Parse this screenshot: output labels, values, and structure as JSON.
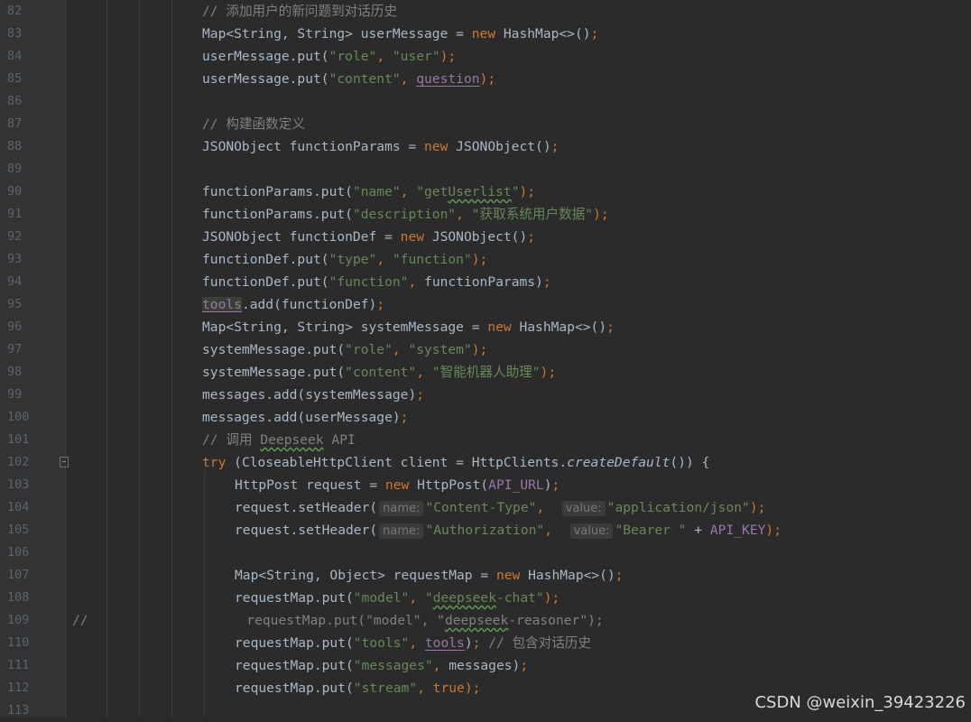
{
  "editor": {
    "lines": [
      {
        "num": "82",
        "indent": 1,
        "tokens": [
          {
            "t": "// 添加用户的新问题到对话历史",
            "c": "comment"
          }
        ]
      },
      {
        "num": "83",
        "indent": 1,
        "tokens": [
          {
            "t": "Map<String, String> userMessage = ",
            "c": "default"
          },
          {
            "t": "new ",
            "c": "keyword"
          },
          {
            "t": "HashMap<>()",
            "c": "default"
          },
          {
            "t": ";",
            "c": "keyword"
          }
        ]
      },
      {
        "num": "84",
        "indent": 1,
        "tokens": [
          {
            "t": "userMessage.put(",
            "c": "default"
          },
          {
            "t": "\"role\"",
            "c": "string"
          },
          {
            "t": ", ",
            "c": "keyword"
          },
          {
            "t": "\"user\"",
            "c": "string"
          },
          {
            "t": ");",
            "c": "keyword"
          }
        ]
      },
      {
        "num": "85",
        "indent": 1,
        "tokens": [
          {
            "t": "userMessage.put(",
            "c": "default"
          },
          {
            "t": "\"content\"",
            "c": "string"
          },
          {
            "t": ", ",
            "c": "keyword"
          },
          {
            "t": "question",
            "c": "field",
            "u": true
          },
          {
            "t": ");",
            "c": "keyword"
          }
        ]
      },
      {
        "num": "86",
        "indent": 1,
        "tokens": []
      },
      {
        "num": "87",
        "indent": 1,
        "tokens": [
          {
            "t": "// 构建函数定义",
            "c": "comment"
          }
        ]
      },
      {
        "num": "88",
        "indent": 1,
        "tokens": [
          {
            "t": "JSONObject functionParams = ",
            "c": "default"
          },
          {
            "t": "new ",
            "c": "keyword"
          },
          {
            "t": "JSONObject()",
            "c": "default"
          },
          {
            "t": ";",
            "c": "keyword"
          }
        ]
      },
      {
        "num": "89",
        "indent": 1,
        "tokens": []
      },
      {
        "num": "90",
        "indent": 1,
        "tokens": [
          {
            "t": "functionParams.put(",
            "c": "default"
          },
          {
            "t": "\"name\"",
            "c": "string"
          },
          {
            "t": ", ",
            "c": "keyword"
          },
          {
            "t": "\"get",
            "c": "string"
          },
          {
            "t": "Userlist",
            "c": "string",
            "w": true
          },
          {
            "t": "\"",
            "c": "string"
          },
          {
            "t": ");",
            "c": "keyword"
          }
        ]
      },
      {
        "num": "91",
        "indent": 1,
        "tokens": [
          {
            "t": "functionParams.put(",
            "c": "default"
          },
          {
            "t": "\"description\"",
            "c": "string"
          },
          {
            "t": ", ",
            "c": "keyword"
          },
          {
            "t": "\"获取系统用户数据\"",
            "c": "string"
          },
          {
            "t": ");",
            "c": "keyword"
          }
        ]
      },
      {
        "num": "92",
        "indent": 1,
        "tokens": [
          {
            "t": "JSONObject functionDef = ",
            "c": "default"
          },
          {
            "t": "new ",
            "c": "keyword"
          },
          {
            "t": "JSONObject()",
            "c": "default"
          },
          {
            "t": ";",
            "c": "keyword"
          }
        ]
      },
      {
        "num": "93",
        "indent": 1,
        "tokens": [
          {
            "t": "functionDef.put(",
            "c": "default"
          },
          {
            "t": "\"type\"",
            "c": "string"
          },
          {
            "t": ", ",
            "c": "keyword"
          },
          {
            "t": "\"function\"",
            "c": "string"
          },
          {
            "t": ");",
            "c": "keyword"
          }
        ]
      },
      {
        "num": "94",
        "indent": 1,
        "tokens": [
          {
            "t": "functionDef.put(",
            "c": "default"
          },
          {
            "t": "\"function\"",
            "c": "string"
          },
          {
            "t": ", ",
            "c": "keyword"
          },
          {
            "t": "functionParams)",
            "c": "default"
          },
          {
            "t": ";",
            "c": "keyword"
          }
        ]
      },
      {
        "num": "95",
        "indent": 1,
        "tokens": [
          {
            "t": "tools",
            "c": "field",
            "u": true,
            "h": true
          },
          {
            "t": ".add(functionDef)",
            "c": "default"
          },
          {
            "t": ";",
            "c": "keyword"
          }
        ]
      },
      {
        "num": "96",
        "indent": 1,
        "tokens": [
          {
            "t": "Map<String, String> systemMessage = ",
            "c": "default"
          },
          {
            "t": "new ",
            "c": "keyword"
          },
          {
            "t": "HashMap<>()",
            "c": "default"
          },
          {
            "t": ";",
            "c": "keyword"
          }
        ]
      },
      {
        "num": "97",
        "indent": 1,
        "tokens": [
          {
            "t": "systemMessage.put(",
            "c": "default"
          },
          {
            "t": "\"role\"",
            "c": "string"
          },
          {
            "t": ", ",
            "c": "keyword"
          },
          {
            "t": "\"system\"",
            "c": "string"
          },
          {
            "t": ");",
            "c": "keyword"
          }
        ]
      },
      {
        "num": "98",
        "indent": 1,
        "tokens": [
          {
            "t": "systemMessage.put(",
            "c": "default"
          },
          {
            "t": "\"content\"",
            "c": "string"
          },
          {
            "t": ", ",
            "c": "keyword"
          },
          {
            "t": "\"智能机器人助理\"",
            "c": "string"
          },
          {
            "t": ");",
            "c": "keyword"
          }
        ]
      },
      {
        "num": "99",
        "indent": 1,
        "tokens": [
          {
            "t": "messages.add(systemMessage)",
            "c": "default"
          },
          {
            "t": ";",
            "c": "keyword"
          }
        ]
      },
      {
        "num": "100",
        "indent": 1,
        "tokens": [
          {
            "t": "messages.add(userMessage)",
            "c": "default"
          },
          {
            "t": ";",
            "c": "keyword"
          }
        ]
      },
      {
        "num": "101",
        "indent": 1,
        "tokens": [
          {
            "t": "// 调用 ",
            "c": "comment"
          },
          {
            "t": "Deepseek",
            "c": "comment",
            "w": true
          },
          {
            "t": " API",
            "c": "comment"
          }
        ]
      },
      {
        "num": "102",
        "indent": 1,
        "tokens": [
          {
            "t": "try ",
            "c": "keyword"
          },
          {
            "t": "(CloseableHttpClient client = HttpClients.",
            "c": "default"
          },
          {
            "t": "createDefault",
            "c": "italic"
          },
          {
            "t": "()) {",
            "c": "default"
          }
        ]
      },
      {
        "num": "103",
        "indent": 2,
        "tokens": [
          {
            "t": "HttpPost request = ",
            "c": "default"
          },
          {
            "t": "new ",
            "c": "keyword"
          },
          {
            "t": "HttpPost(",
            "c": "default"
          },
          {
            "t": "API_URL",
            "c": "field"
          },
          {
            "t": ")",
            "c": "default"
          },
          {
            "t": ";",
            "c": "keyword"
          }
        ]
      },
      {
        "num": "104",
        "indent": 2,
        "tokens": [
          {
            "t": "request.setHeader(",
            "c": "default"
          },
          {
            "t": "name:",
            "c": "hint"
          },
          {
            "t": "\"Content-Type\"",
            "c": "string"
          },
          {
            "t": ",  ",
            "c": "keyword"
          },
          {
            "t": "value:",
            "c": "hint"
          },
          {
            "t": "\"application/json\"",
            "c": "string"
          },
          {
            "t": ");",
            "c": "keyword"
          }
        ]
      },
      {
        "num": "105",
        "indent": 2,
        "tokens": [
          {
            "t": "request.setHeader(",
            "c": "default"
          },
          {
            "t": "name:",
            "c": "hint"
          },
          {
            "t": "\"Authorization\"",
            "c": "string"
          },
          {
            "t": ",  ",
            "c": "keyword"
          },
          {
            "t": "value:",
            "c": "hint"
          },
          {
            "t": "\"Bearer \"",
            "c": "string"
          },
          {
            "t": " + ",
            "c": "default"
          },
          {
            "t": "API_KEY",
            "c": "field"
          },
          {
            "t": ");",
            "c": "keyword"
          }
        ]
      },
      {
        "num": "106",
        "indent": 2,
        "tokens": []
      },
      {
        "num": "107",
        "indent": 2,
        "tokens": [
          {
            "t": "Map<String, Object> requestMap = ",
            "c": "default"
          },
          {
            "t": "new ",
            "c": "keyword"
          },
          {
            "t": "HashMap<>()",
            "c": "default"
          },
          {
            "t": ";",
            "c": "keyword"
          }
        ]
      },
      {
        "num": "108",
        "indent": 2,
        "tokens": [
          {
            "t": "requestMap.put(",
            "c": "default"
          },
          {
            "t": "\"model\"",
            "c": "string"
          },
          {
            "t": ", ",
            "c": "keyword"
          },
          {
            "t": "\"",
            "c": "string"
          },
          {
            "t": "deepseek",
            "c": "string",
            "w": true
          },
          {
            "t": "-chat\"",
            "c": "string"
          },
          {
            "t": ");",
            "c": "keyword"
          }
        ]
      },
      {
        "num": "109",
        "indent": 0,
        "tokens": [
          {
            "t": "//                    requestMap.put(\"model\", \"",
            "c": "comment"
          },
          {
            "t": "deepseek",
            "c": "comment",
            "w": true
          },
          {
            "t": "-reasoner\");",
            "c": "comment"
          }
        ]
      },
      {
        "num": "110",
        "indent": 2,
        "tokens": [
          {
            "t": "requestMap.put(",
            "c": "default"
          },
          {
            "t": "\"tools\"",
            "c": "string"
          },
          {
            "t": ", ",
            "c": "keyword"
          },
          {
            "t": "tools",
            "c": "field",
            "u": true
          },
          {
            "t": ")",
            "c": "default"
          },
          {
            "t": "; ",
            "c": "keyword"
          },
          {
            "t": "// 包含对话历史",
            "c": "comment"
          }
        ]
      },
      {
        "num": "111",
        "indent": 2,
        "tokens": [
          {
            "t": "requestMap.put(",
            "c": "default"
          },
          {
            "t": "\"messages\"",
            "c": "string"
          },
          {
            "t": ", ",
            "c": "keyword"
          },
          {
            "t": "messages)",
            "c": "default"
          },
          {
            "t": ";",
            "c": "keyword"
          }
        ]
      },
      {
        "num": "112",
        "indent": 2,
        "tokens": [
          {
            "t": "requestMap.put(",
            "c": "default"
          },
          {
            "t": "\"stream\"",
            "c": "string"
          },
          {
            "t": ", ",
            "c": "keyword"
          },
          {
            "t": "true",
            "c": "keyword"
          },
          {
            "t": ");",
            "c": "keyword"
          }
        ]
      },
      {
        "num": "113",
        "indent": 2,
        "tokens": []
      }
    ]
  },
  "watermark": {
    "text": "CSDN @weixin_39423226"
  },
  "colors": {
    "background": "#2b2b2b",
    "gutter": "#313335",
    "default": "#a9b7c6",
    "keyword": "#cc7832",
    "string": "#6a8759",
    "comment": "#808080",
    "field": "#9876aa",
    "line_number": "#606366"
  }
}
